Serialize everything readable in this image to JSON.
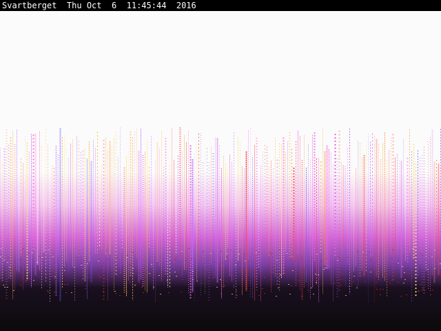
{
  "overlay": {
    "text": "Svartberget  Thu Oct  6  11:45:44  2016"
  },
  "image": {
    "description_colors": {
      "sky": "#fbfbfb",
      "ground": "#0b0a0b",
      "magenta": "#e05fe0",
      "orange": "#f0a040"
    }
  }
}
